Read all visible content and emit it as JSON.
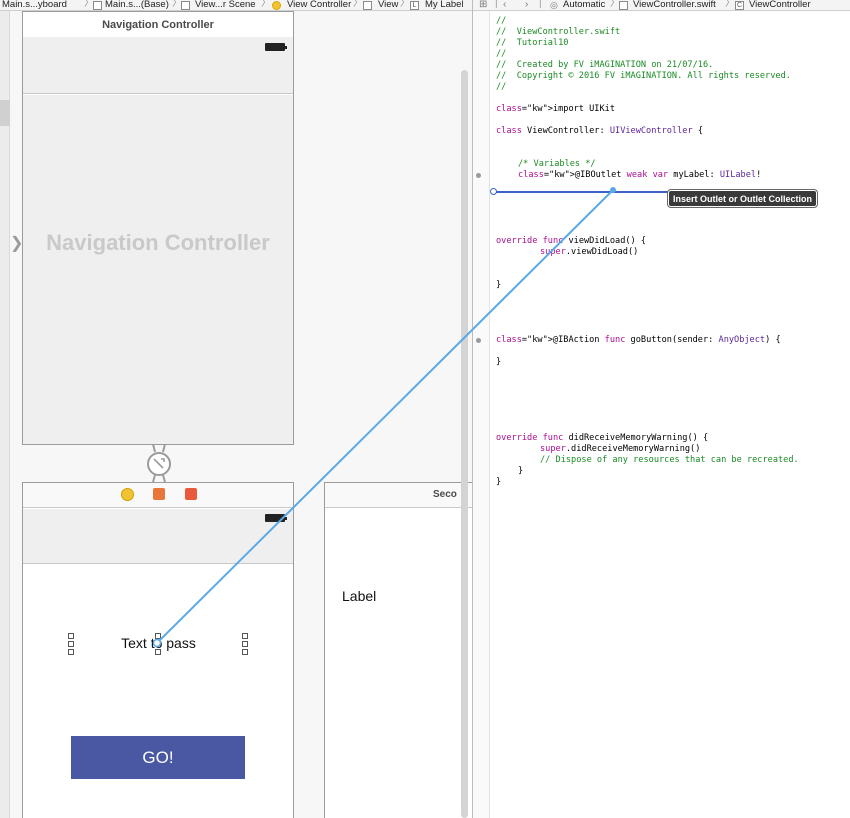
{
  "ib_breadcrumb": {
    "items": [
      "Main.s...yboard",
      "Main.s...(Base)",
      "View...r Scene",
      "View Controller",
      "View",
      "My Label"
    ]
  },
  "editor_breadcrumb": {
    "mode": "Automatic",
    "file": "ViewController.swift",
    "symbol": "ViewController"
  },
  "nav_scene": {
    "title": "Navigation Controller",
    "placeholder": "Navigation Controller"
  },
  "vc_scene": {
    "text_label": "Text to pass",
    "go_button": "GO!"
  },
  "second_scene": {
    "title_fragment": "Seco",
    "label": "Label"
  },
  "code": {
    "lines": [
      "//",
      "//  ViewController.swift",
      "//  Tutorial10",
      "//",
      "//  Created by FV iMAGINATION on 21/07/16.",
      "//  Copyright © 2016 FV iMAGINATION. All rights reserved.",
      "//",
      "import UIKit",
      "class ViewController: UIViewController {",
      "/* Variables */",
      "@IBOutlet weak var myLabel: UILabel!",
      "override func viewDidLoad() {",
      "super.viewDidLoad()",
      "}",
      "@IBAction func goButton(sender: AnyObject) {",
      "}",
      "override func didReceiveMemoryWarning() {",
      "super.didReceiveMemoryWarning()",
      "// Dispose of any resources that can be recreated.",
      "}",
      "}"
    ]
  },
  "tooltip": "Insert Outlet or Outlet Collection",
  "colors": {
    "comment": "#1a8a24",
    "keyword": "#aa0d91",
    "type": "#5c2699",
    "button": "#4a57a3",
    "connection": "#5aa9e6"
  }
}
